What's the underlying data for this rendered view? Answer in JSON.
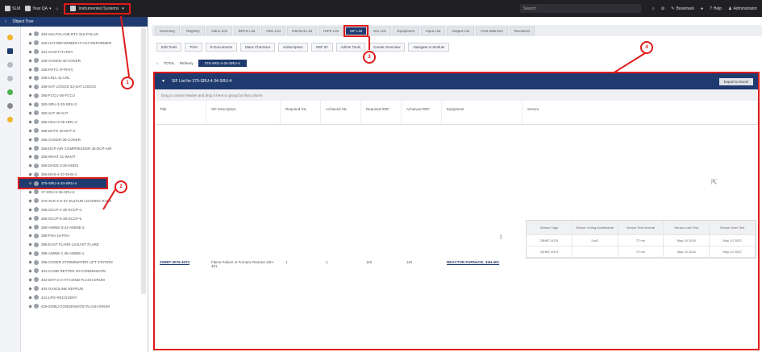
{
  "topbar": {
    "items": [
      "SLM",
      "Year QA",
      "Instrumented Systems"
    ],
    "search_placeholder": "Search",
    "right_items": [
      "Bookmark",
      "Help",
      "Administrator"
    ]
  },
  "left": {
    "header": "Object Tree",
    "tree": [
      "304-SULFOLANE BTX SULFOLAN",
      "320-HAT-REFORMER-IT-HAT-REFORMER",
      "321-CHSIY-IT-HWY",
      "330-COKER-40-COKER",
      "335-PHTC-IT-PHTC",
      "338-LRLL-11-LRL",
      "339-SAT LOGOS 33-SAT LOGOS",
      "365-FCCU-36-FCCU",
      "360-SRU-3-33-SRU-3",
      "360-SAT 36-SAT",
      "365-HDU-3-36-HDU-3",
      "365-DHTS 40-DHT-S",
      "365-COKER-36-COKER",
      "365-DCP-AIR COMPRESSOR 36-DCP-AIR",
      "365-WHAT 31-WHAT",
      "365-DHDS 3-36-DHDS",
      "365-DHS-4-37-DHS-4",
      "375-SRU-4-34-SRU-4",
      "37-SRU-5-35-SRU-5",
      "375-SLR-4-S-37-SULFUR LOADING RACK",
      "365-SCCP-4-35-SCCP-4",
      "365-SCCP-5-38-SCCP-5",
      "368-AMINE-3-42-AMINE-3",
      "388-PSA-16-PSA",
      "395-EAST FLARE-12-EAST FLARE",
      "396-AMINE-1 36-AMINE-1",
      "396-COKER STORMWATER LIFT STATION",
      "401-COND RETTER 40-CONDENSATE",
      "402-DHT-2-4-HT-COND-FLASH DRUM",
      "404-GASOLINE REFRUN",
      "421-LPG-RECOVERY",
      "429-SOBU-CONDENSATE-FLASH DRUM"
    ],
    "selected_index": 17
  },
  "tabs": [
    "Summary",
    "Registry",
    "Alarm List",
    "BPCS List",
    "F&G List",
    "Interlock List",
    "HIPS List",
    "SIF List",
    "SIS List",
    "Equipment",
    "Input List",
    "Output List",
    "CSS Matrices",
    "Revisions"
  ],
  "active_tab": 7,
  "toolbar": [
    "Edit Tools",
    "Print",
    "E-Documents",
    "Mass Checkout",
    "Subscription",
    "SRF ID",
    "Admin Tools",
    "Create Overview",
    "Navigate to Module"
  ],
  "crumbs": [
    "TOTAL",
    "Refinery",
    "375-SRU-4-34-SRU-4"
  ],
  "panel": {
    "title": "SIF List for 375-SRU-4-34-SRU-4",
    "export": "Export to Excel",
    "group_hint": "Drag a column header and drop it here to group by that column",
    "columns": [
      "Title",
      "SIF Description",
      "Required SIL",
      "Achieved SIL",
      "Required RRF",
      "Achieved RRF",
      "Equipment",
      "Sensor"
    ],
    "row": {
      "title": "20HBT-4076-4074",
      "description": "Flame Failure in Furnace Reactor 34H-401",
      "req_sil": "1",
      "ach_sil": "1",
      "req_rrf": "110",
      "ach_rrf": "116",
      "equipment": "REACTOR FURNACE, 34H-401"
    },
    "sensor_table": {
      "headers": [
        "Sensor Tags",
        "Sensor Voting Architecture",
        "Sensor Test Interval",
        "Sensor Last Test",
        "Sensor Next Test"
      ],
      "rows": [
        [
          "20HBT-4076",
          "2oo2",
          "72 mo",
          "May 10 2016",
          "May 10 2022"
        ],
        [
          "20HBT-4074",
          "",
          "72 mo",
          "May 10 2016",
          "May 10 2022"
        ]
      ]
    }
  },
  "annotations": [
    "1",
    "2",
    "3",
    "4"
  ]
}
